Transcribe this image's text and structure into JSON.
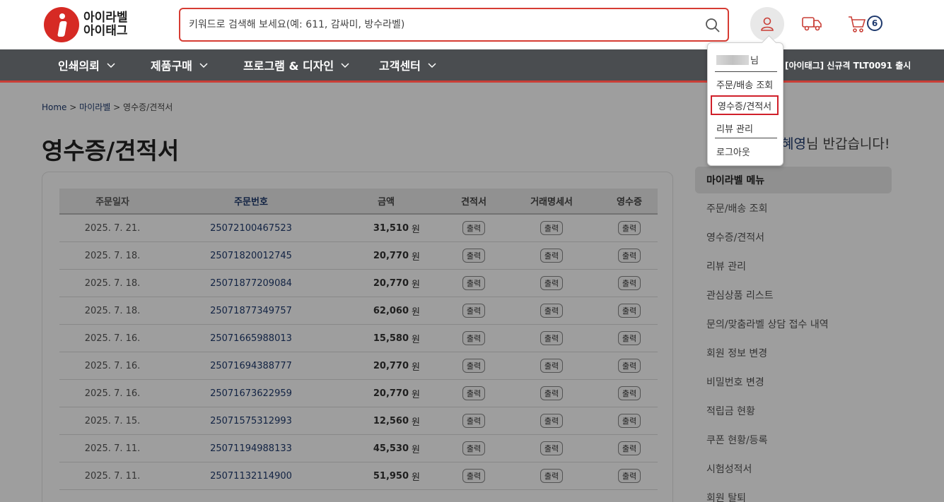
{
  "header": {
    "logo_line1": "아이라벨",
    "logo_line2": "아이태그",
    "search_placeholder": "키워드로 검색해 보세요(예: 611, 감싸미, 방수라벨)",
    "cart_count": "6"
  },
  "nav": {
    "items": [
      {
        "label": "인쇄의뢰"
      },
      {
        "label": "제품구매"
      },
      {
        "label": "프로그램 & 디자인"
      },
      {
        "label": "고객센터"
      }
    ],
    "notice": "[아이태그] 신규격 TLT0091 출시"
  },
  "breadcrumb": {
    "home": "Home",
    "sep1": ">",
    "mid": "마이라벨",
    "sep2": ">",
    "current": "영수증/견적서"
  },
  "page_title": "영수증/견적서",
  "table": {
    "headers": [
      "주문일자",
      "주문번호",
      "금액",
      "견적서",
      "거래명세서",
      "영수증"
    ],
    "button_label": "출력",
    "currency": "원",
    "rows": [
      {
        "date": "2025. 7. 21.",
        "order": "25072100467523",
        "amount": "31,510"
      },
      {
        "date": "2025. 7. 18.",
        "order": "25071820012745",
        "amount": "20,770"
      },
      {
        "date": "2025. 7. 18.",
        "order": "25071877209084",
        "amount": "20,770"
      },
      {
        "date": "2025. 7. 18.",
        "order": "25071877349757",
        "amount": "62,060"
      },
      {
        "date": "2025. 7. 16.",
        "order": "25071665988013",
        "amount": "15,580"
      },
      {
        "date": "2025. 7. 16.",
        "order": "25071694388777",
        "amount": "20,770"
      },
      {
        "date": "2025. 7. 16.",
        "order": "25071673622959",
        "amount": "20,770"
      },
      {
        "date": "2025. 7. 15.",
        "order": "25071575312993",
        "amount": "12,560"
      },
      {
        "date": "2025. 7. 11.",
        "order": "25071194988133",
        "amount": "45,530"
      },
      {
        "date": "2025. 7. 11.",
        "order": "25071132114900",
        "amount": "51,950"
      }
    ]
  },
  "sidebar": {
    "greeting_name": "혜영",
    "greeting_rest": "님 반갑습니다!",
    "menu_title": "마이라벨 메뉴",
    "items": [
      {
        "label": "주문/배송 조회"
      },
      {
        "label": "영수증/견적서"
      },
      {
        "label": "리뷰 관리"
      },
      {
        "label": "관심상품 리스트"
      },
      {
        "label": "문의/맞춤라벨 상담 접수 내역"
      },
      {
        "label": "회원 정보 변경"
      },
      {
        "label": "비밀번호 변경"
      },
      {
        "label": "적립금 현황"
      },
      {
        "label": "쿠폰 현황/등록"
      },
      {
        "label": "시험성적서"
      },
      {
        "label": "회원 탈퇴"
      }
    ]
  },
  "dropdown": {
    "user_suffix": "님",
    "items": [
      {
        "label": "주문/배송 조회"
      },
      {
        "label": "영수증/견적서"
      },
      {
        "label": "리뷰 관리"
      },
      {
        "label": "로그아웃"
      }
    ]
  },
  "colors": {
    "brand_red": "#d62a24",
    "nav_bg": "#4a4d50",
    "link_navy": "#1f3a6e",
    "highlight_red": "#d0202a"
  }
}
